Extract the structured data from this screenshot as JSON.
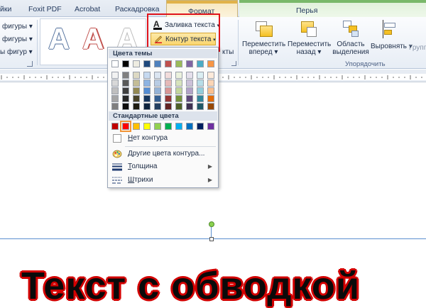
{
  "tabs": {
    "items": [
      "йки",
      "Foxit PDF",
      "Acrobat",
      "Раскадровка"
    ],
    "context_format": "Формат",
    "context_pens": "Перья"
  },
  "ribbon": {
    "left": {
      "row1": "фигуры ▾",
      "row2": "фигуры ▾",
      "row3": "ы фигур ▾"
    },
    "wordart_letter": "A",
    "fill_text": "Заливка текста",
    "outline_text": "Контур текста",
    "group_tail": "кты",
    "arrange": {
      "bring_forward_l1": "Переместить",
      "bring_forward_l2": "вперед ▾",
      "send_backward_l1": "Переместить",
      "send_backward_l2": "назад ▾",
      "selection_l1": "Область",
      "selection_l2": "выделения",
      "align": "Выровнять ▾",
      "group_cut": "Групп",
      "group_title": "Упорядочить"
    }
  },
  "menu": {
    "theme_colors_header": "Цвета темы",
    "standard_colors_header": "Стандартные цвета",
    "no_outline_pre": "",
    "no_outline_u": "Н",
    "no_outline_post": "ет контура",
    "more_colors_pre": "",
    "more_colors_u": "Д",
    "more_colors_post": "ругие цвета контура...",
    "weight_pre": "",
    "weight_u": "Т",
    "weight_post": "олщина",
    "dashes_pre": "",
    "dashes_u": "Ш",
    "dashes_post": "трихи",
    "theme_top": [
      "#ffffff",
      "#000000",
      "#eeece1",
      "#1f497d",
      "#4f81bd",
      "#c0504d",
      "#9bbb59",
      "#8064a2",
      "#4bacc6",
      "#f79646"
    ],
    "theme_shades": [
      [
        "#f2f2f2",
        "#7f7f7f",
        "#ddd9c3",
        "#c6d9f0",
        "#dbe5f1",
        "#f2dcdb",
        "#ebf1dd",
        "#e5e0ec",
        "#dbeef3",
        "#fdeada"
      ],
      [
        "#d8d8d8",
        "#595959",
        "#c4bd97",
        "#8db3e2",
        "#b8cce4",
        "#e5b9b7",
        "#d7e3bc",
        "#ccc1d9",
        "#b7dde8",
        "#fbd5b5"
      ],
      [
        "#bfbfbf",
        "#3f3f3f",
        "#938953",
        "#548dd4",
        "#95b3d7",
        "#d99694",
        "#c3d69b",
        "#b2a2c7",
        "#92cddc",
        "#fac08f"
      ],
      [
        "#a5a5a5",
        "#262626",
        "#494429",
        "#17365d",
        "#366092",
        "#953734",
        "#76923c",
        "#5f497a",
        "#31859b",
        "#e36c09"
      ],
      [
        "#7f7f7f",
        "#0c0c0c",
        "#1d1b10",
        "#0f243e",
        "#244061",
        "#632423",
        "#4f6128",
        "#3f3151",
        "#205867",
        "#974806"
      ]
    ],
    "standard": [
      "#c00000",
      "#ff0000",
      "#ffc000",
      "#ffff00",
      "#92d050",
      "#00b050",
      "#00b0f0",
      "#0070c0",
      "#002060",
      "#7030a0"
    ],
    "selected_standard_index": 1
  },
  "document": {
    "text": "Текст с обводкой",
    "outline_color": "#d20000"
  },
  "colors": {
    "highlight_box": "#e0141c"
  }
}
